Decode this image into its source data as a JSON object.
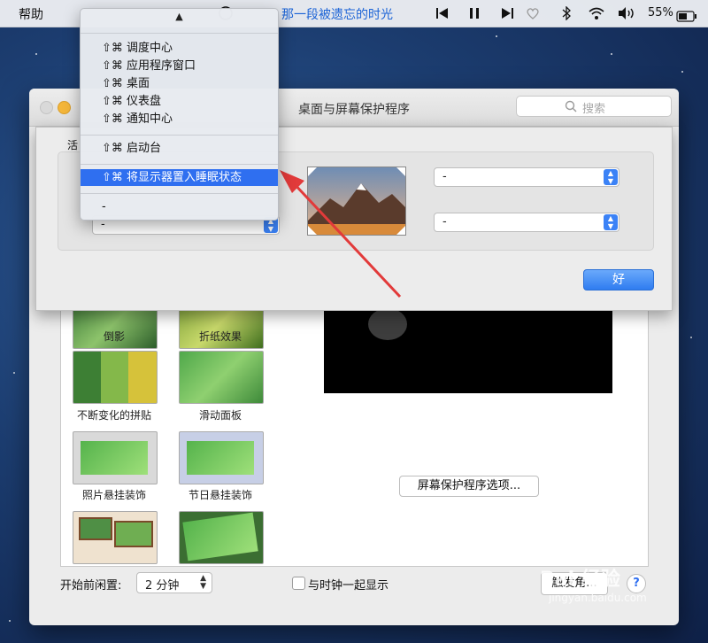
{
  "menubar": {
    "help": "帮助",
    "song": "那一段被遗忘的时光",
    "battery": "55%"
  },
  "window": {
    "title": "桌面与屏幕保护程序",
    "search_placeholder": "搜索"
  },
  "sheet": {
    "label_partial": "活",
    "top_left_value": "-",
    "bottom_left_value": "-",
    "top_right_value": "-",
    "bottom_right_value": "-",
    "ok_label": "好"
  },
  "menu": {
    "groups": [
      [
        "⇧⌘ 调度中心",
        "⇧⌘ 应用程序窗口",
        "⇧⌘ 桌面",
        "⇧⌘ 仪表盘",
        "⇧⌘ 通知中心"
      ],
      [
        "⇧⌘ 启动台"
      ],
      [
        "⇧⌘ 将显示器置入睡眠状态"
      ],
      [
        "-"
      ]
    ],
    "selected": "⇧⌘ 将显示器置入睡眠状态"
  },
  "savers": [
    {
      "label": "倒影"
    },
    {
      "label": "折纸效果"
    },
    {
      "label": "不断变化的拼贴"
    },
    {
      "label": "滑动面板"
    },
    {
      "label": "照片悬挂装饰"
    },
    {
      "label": "节日悬挂装饰"
    }
  ],
  "preview": {
    "options_button": "屏幕保护程序选项..."
  },
  "bottom": {
    "idle_label": "开始前闲置:",
    "idle_value": "2 分钟",
    "clock_label": "与时钟一起显示",
    "hot_corners_button": "触发角...",
    "help_button": "?"
  },
  "watermark": {
    "text": "Bai 经验",
    "sub": "jingyan.baidu.com"
  },
  "colors": {
    "accent": "#2f6ff0",
    "link": "#1b63d6",
    "arrow": "#e23a3a"
  }
}
